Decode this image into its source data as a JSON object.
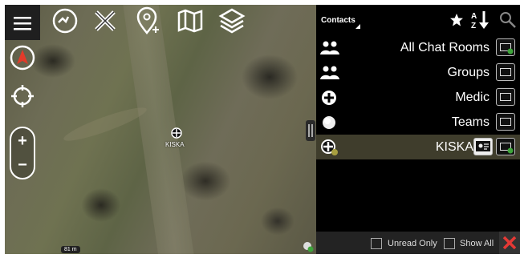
{
  "map": {
    "marker_label": "KISKA",
    "scale_label": "81 m",
    "zoom_plus": "+",
    "zoom_minus": "−"
  },
  "toolbar_icons": [
    "menu-icon",
    "wave-icon",
    "tools-icon",
    "add-point-icon",
    "map-icon",
    "layers-icon",
    "compass-icon",
    "locate-icon"
  ],
  "contacts": {
    "title": "Contacts",
    "star": "★",
    "sort_az": "A Z",
    "items": [
      {
        "label": "All Chat Rooms",
        "icon": "group-icon"
      },
      {
        "label": "Groups",
        "icon": "group-icon"
      },
      {
        "label": "Medic",
        "icon": "medic-icon"
      },
      {
        "label": "Teams",
        "icon": "team-icon"
      },
      {
        "label": "KISKA",
        "icon": "self-icon"
      }
    ],
    "footer": {
      "unread_only": "Unread Only",
      "show_all": "Show All"
    }
  },
  "colors": {
    "accent_green": "#3ea53b",
    "close_red": "#e53935",
    "selected_row": "#3f3d2c"
  }
}
